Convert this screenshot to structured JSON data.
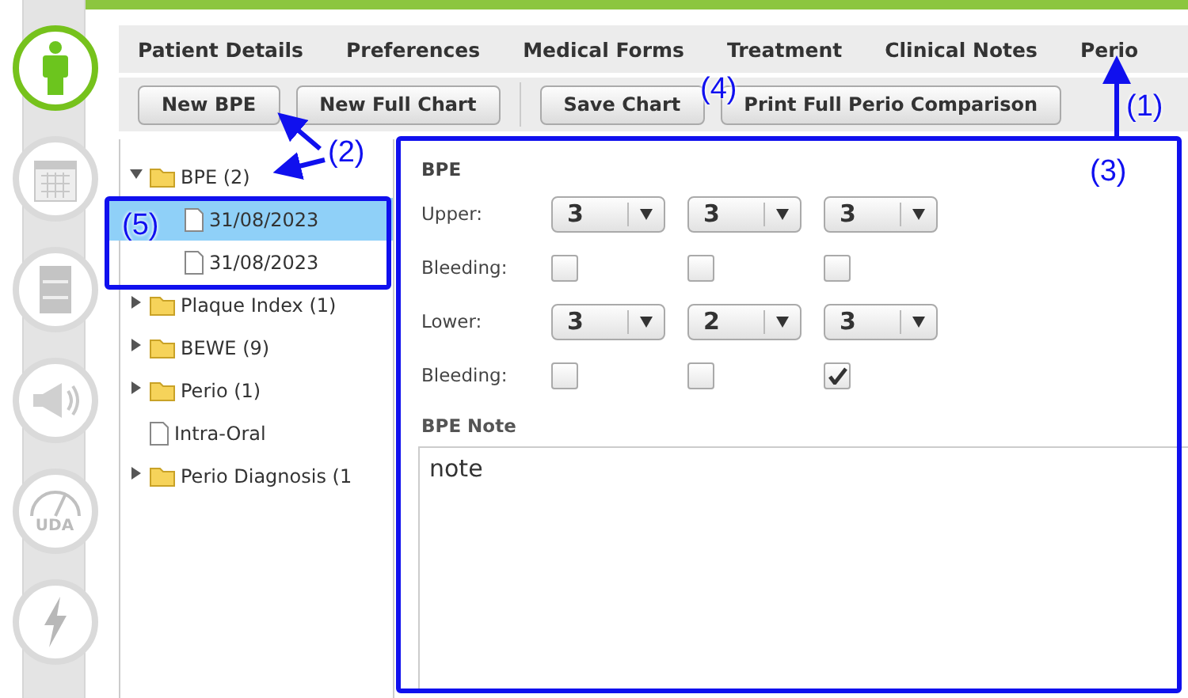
{
  "sidebar": {
    "icons": [
      {
        "kind": "person",
        "selected": true
      },
      {
        "kind": "calendar",
        "selected": false
      },
      {
        "kind": "cabinet",
        "selected": false
      },
      {
        "kind": "megaphone",
        "selected": false
      },
      {
        "kind": "gauge",
        "label": "UDA",
        "selected": false
      },
      {
        "kind": "lightning",
        "selected": false
      }
    ]
  },
  "tabs": [
    "Patient Details",
    "Preferences",
    "Medical Forms",
    "Treatment",
    "Clinical Notes",
    "Perio"
  ],
  "toolbar": {
    "groups": [
      [
        "New BPE",
        "New Full Chart"
      ],
      [
        "Save Chart",
        "Print Full Perio Comparison"
      ]
    ]
  },
  "tree": [
    {
      "label": "BPE (2)",
      "kind": "folder",
      "expanded": true,
      "selected": false,
      "children": [
        {
          "label": "31/08/2023",
          "kind": "file",
          "selected": true
        },
        {
          "label": "31/08/2023",
          "kind": "file",
          "selected": false
        }
      ]
    },
    {
      "label": "Plaque Index (1)",
      "kind": "folder",
      "expanded": false,
      "selected": false
    },
    {
      "label": "BEWE (9)",
      "kind": "folder",
      "expanded": false,
      "selected": false
    },
    {
      "label": "Perio (1)",
      "kind": "folder",
      "expanded": false,
      "selected": false
    },
    {
      "label": "Intra-Oral",
      "kind": "file",
      "selected": false
    },
    {
      "label": "Perio Diagnosis (1",
      "kind": "folder",
      "expanded": false,
      "selected": false
    }
  ],
  "form": {
    "title": "BPE",
    "rows": [
      {
        "kind": "select",
        "label": "Upper:",
        "values": [
          "3",
          "3",
          "3"
        ]
      },
      {
        "kind": "checks",
        "label": "Bleeding:",
        "checked": [
          false,
          false,
          false
        ]
      },
      {
        "kind": "select",
        "label": "Lower:",
        "values": [
          "3",
          "2",
          "3"
        ]
      },
      {
        "kind": "checks",
        "label": "Bleeding:",
        "checked": [
          false,
          false,
          true
        ]
      }
    ],
    "note_label": "BPE Note",
    "note": "note"
  },
  "annotations": [
    "(1)",
    "(2)",
    "(3)",
    "(4)",
    "(5)"
  ]
}
